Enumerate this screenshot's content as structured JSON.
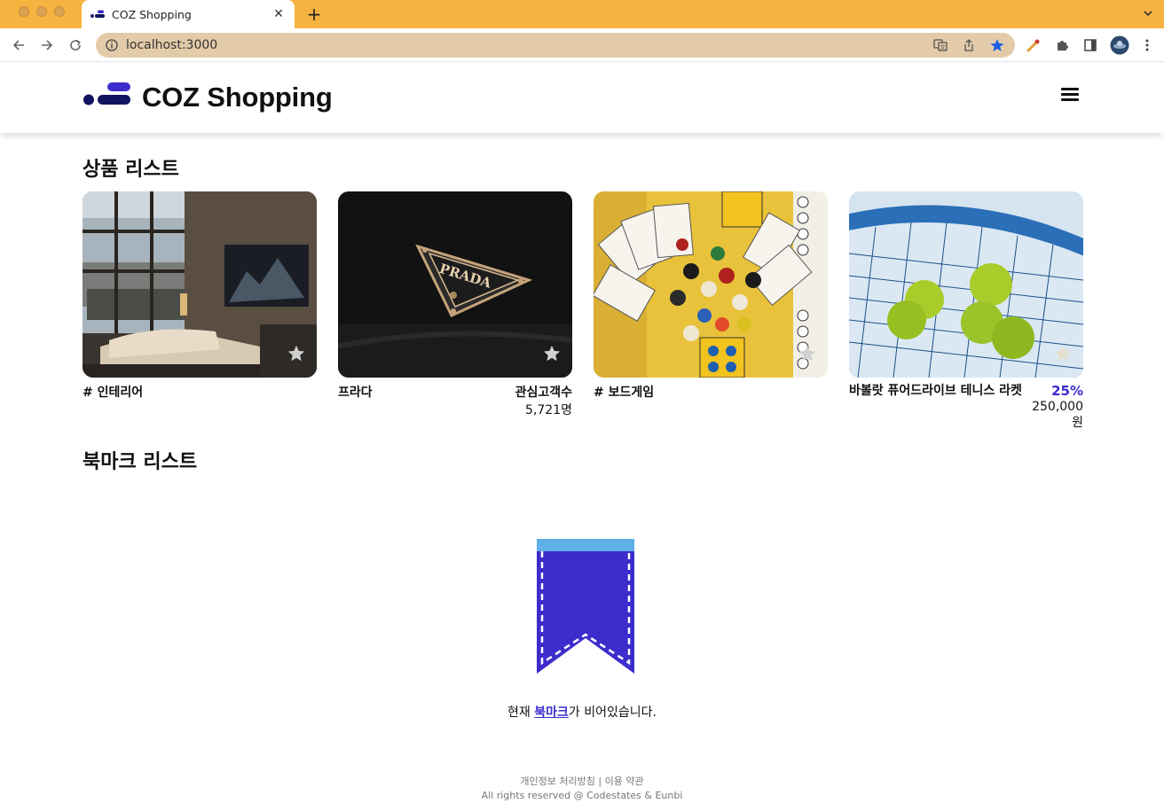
{
  "browser": {
    "tab_title": "COZ Shopping",
    "url": "localhost:3000",
    "accent_color": "#f7b340"
  },
  "header": {
    "brand": "COZ Shopping",
    "logo_colors": [
      "#13145f",
      "#3c2ccc"
    ],
    "menu_icon": "hamburger-icon"
  },
  "products": {
    "title": "상품 리스트",
    "items": [
      {
        "type": "category",
        "title": "# 인테리어",
        "image": "living-room-photo"
      },
      {
        "type": "brand",
        "title": "프라다",
        "right_label": "관심고객수",
        "right_value": "5,721명",
        "image": "prada-logo-photo"
      },
      {
        "type": "category",
        "title": "# 보드게임",
        "image": "board-game-photo"
      },
      {
        "type": "product",
        "title": "바볼랏 퓨어드라이브 테니스 라켓",
        "discount": "25%",
        "price": "250,000",
        "unit": "원",
        "image": "tennis-racket-photo"
      }
    ]
  },
  "bookmarks": {
    "title": "북마크 리스트",
    "empty_prefix": "현재 ",
    "empty_link": "북마크",
    "empty_suffix": "가 비어있습니다.",
    "accent_color": "#3c2ccc"
  },
  "footer": {
    "line1": "개인정보 처리방침 | 이용 약관",
    "line2": "All rights reserved @ Codestates & Eunbi"
  }
}
